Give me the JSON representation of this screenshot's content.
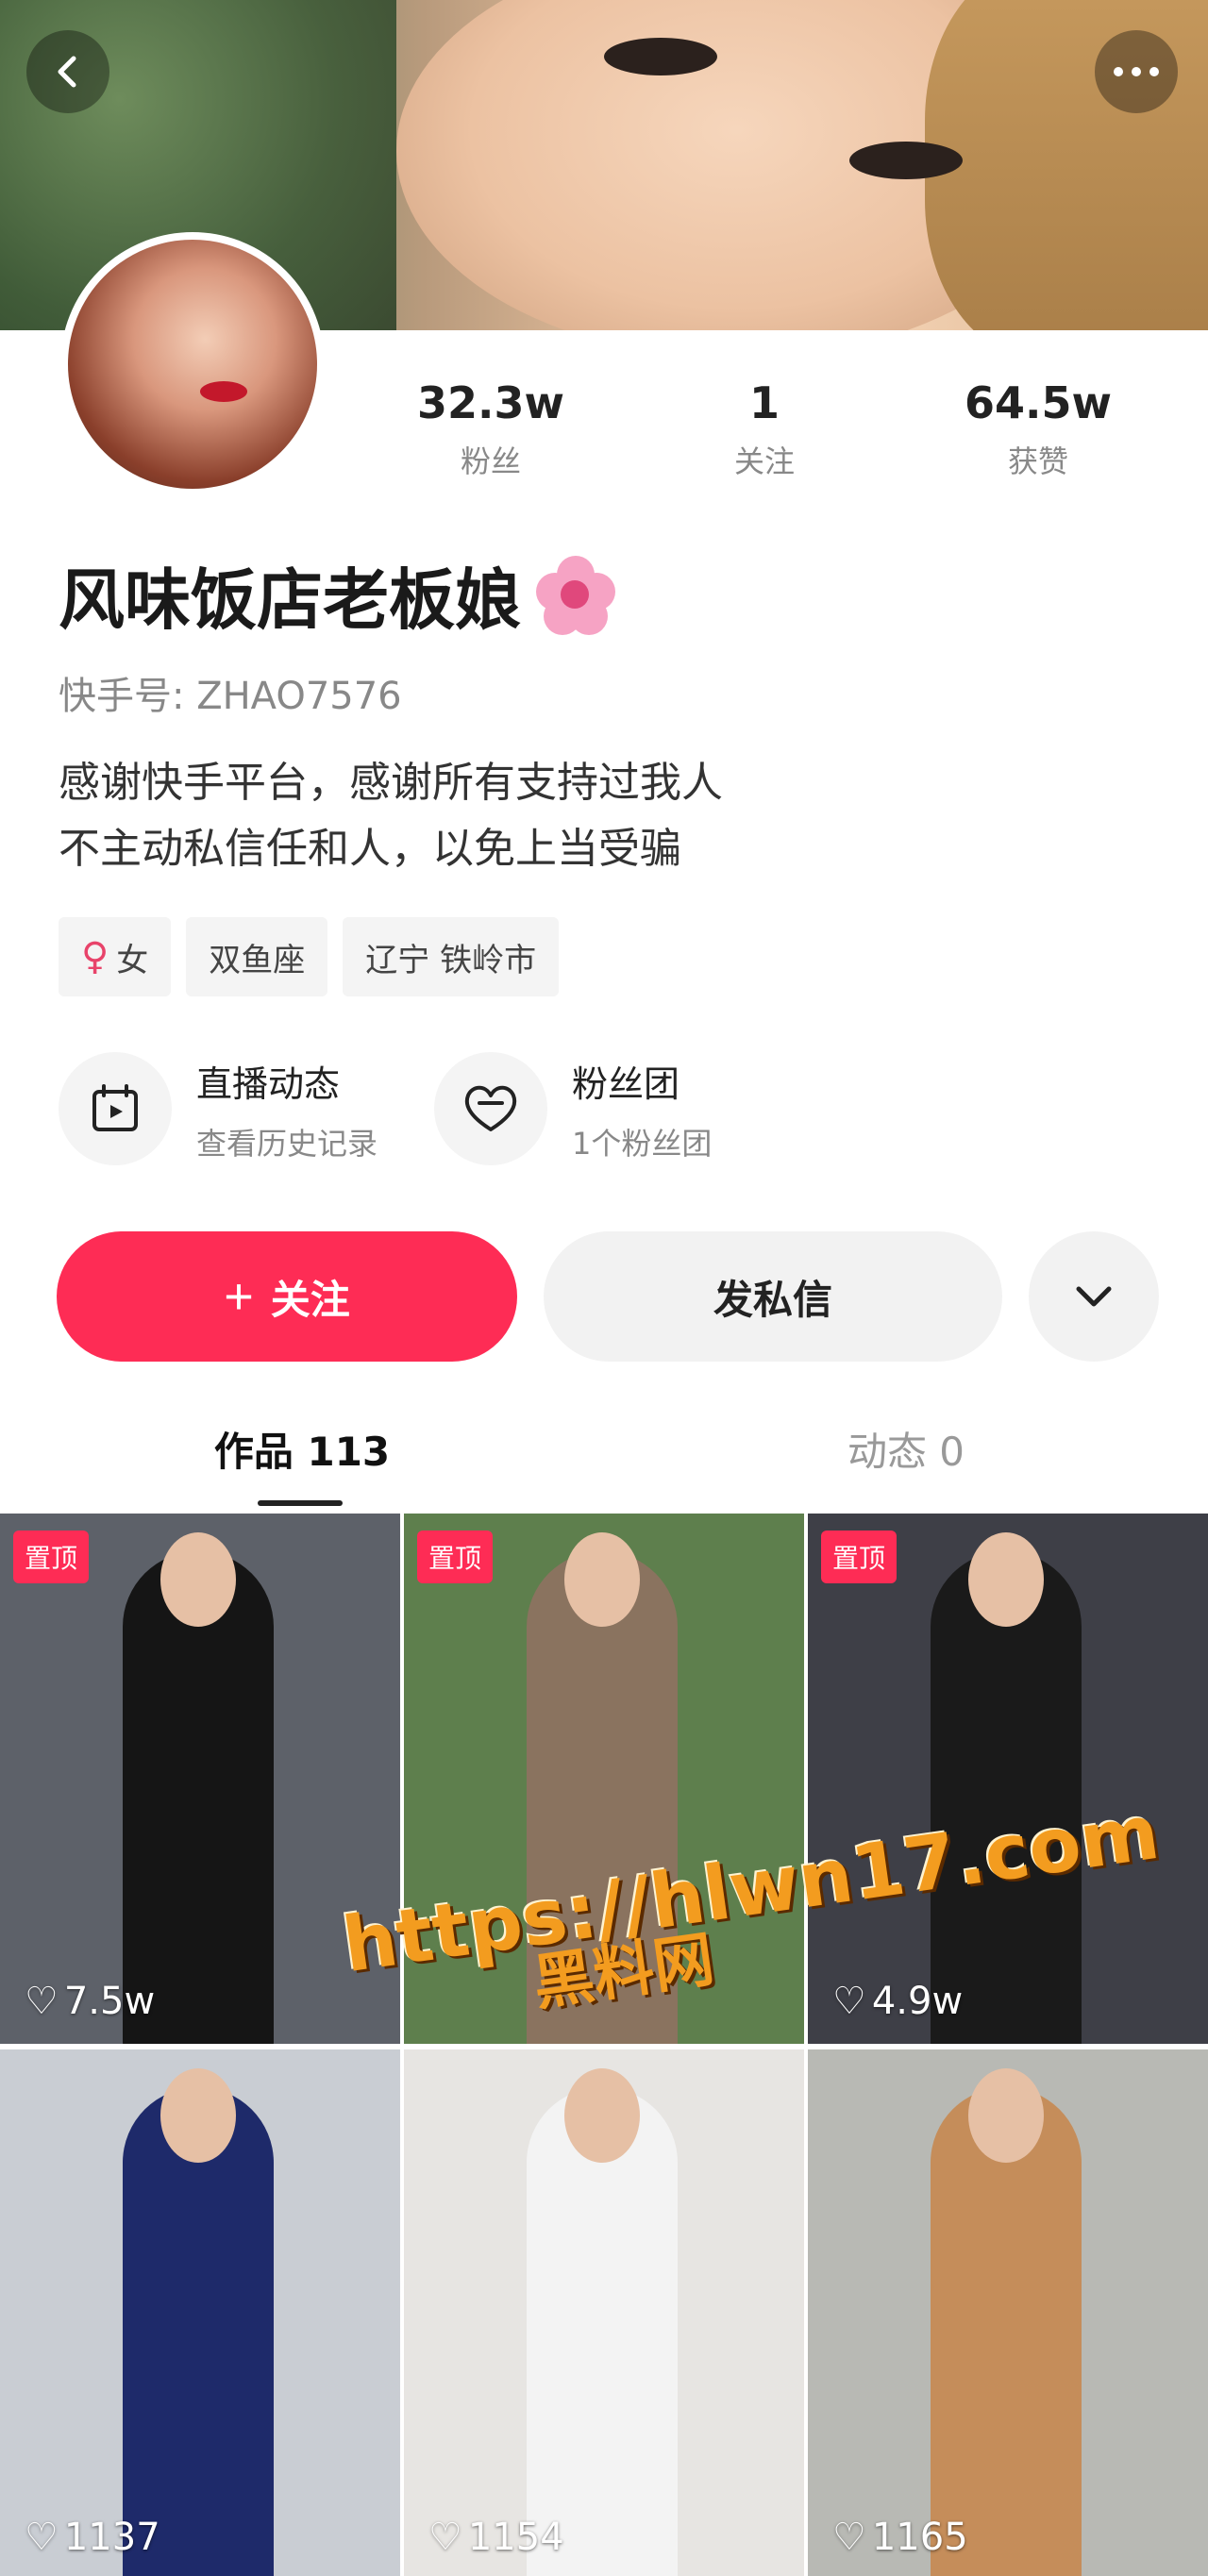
{
  "header": {
    "back_icon": "chevron-left-icon",
    "more_icon": "more-dots-icon"
  },
  "stats": [
    {
      "value": "32.3w",
      "label": "粉丝"
    },
    {
      "value": "1",
      "label": "关注"
    },
    {
      "value": "64.5w",
      "label": "获赞"
    }
  ],
  "profile": {
    "nickname": "风味饭店老板娘",
    "uid": "快手号: ZHAO7576",
    "bio_line1": "感谢快手平台，感谢所有支持过我人",
    "bio_line2": "不主动私信任和人，以免上当受骗"
  },
  "tags": {
    "gender_symbol": "♀",
    "gender": "女",
    "zodiac": "双鱼座",
    "location": "辽宁 铁岭市"
  },
  "entries": {
    "live_title": "直播动态",
    "live_sub": "查看历史记录",
    "fans_title": "粉丝团",
    "fans_sub": "1个粉丝团"
  },
  "actions": {
    "follow_plus": "+",
    "follow_label": "关注",
    "message_label": "发私信"
  },
  "tabs": {
    "works": "作品 113",
    "moments": "动态 0"
  },
  "videos": [
    {
      "pinned": "置顶",
      "likes": "7.5w",
      "bg": "#5d6169",
      "outfit": "#151515"
    },
    {
      "pinned": "置顶",
      "likes": "",
      "bg": "#5e7f4d",
      "outfit": "#8a735f"
    },
    {
      "pinned": "置顶",
      "likes": "4.9w",
      "bg": "#3e3f47",
      "outfit": "#1a1a1a"
    },
    {
      "pinned": "",
      "likes": "1137",
      "bg": "#c9cdd3",
      "outfit": "#1e2a6a"
    },
    {
      "pinned": "",
      "likes": "1154",
      "bg": "#e7e5e2",
      "outfit": "#f3f3f3"
    },
    {
      "pinned": "",
      "likes": "1165",
      "bg": "#b8b9b4",
      "outfit": "#c58d5a"
    }
  ],
  "watermark": {
    "url": "https://hlwn17.com",
    "cn": "黑料网"
  },
  "colors": {
    "accent": "#fe2c55",
    "watermark": "#f39c1f"
  }
}
